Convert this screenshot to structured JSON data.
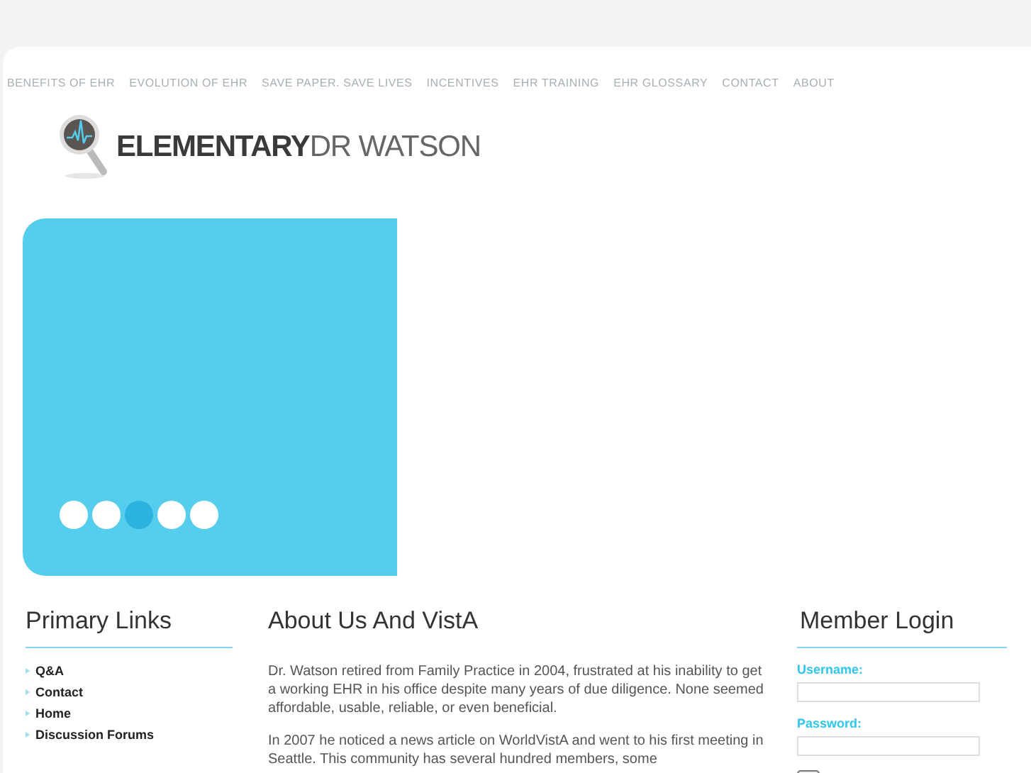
{
  "nav": [
    "BENEFITS OF EHR",
    "EVOLUTION OF EHR",
    "SAVE PAPER. SAVE LIVES",
    "INCENTIVES",
    "EHR TRAINING",
    "EHR GLOSSARY",
    "CONTACT",
    "ABOUT"
  ],
  "logo": {
    "strong": "ELEMENTARY",
    "light": "DR WATSON"
  },
  "slider": {
    "dots": [
      {
        "selected": false
      },
      {
        "selected": false
      },
      {
        "selected": true
      },
      {
        "selected": false
      },
      {
        "selected": false
      }
    ]
  },
  "primary_links": {
    "title": "Primary Links",
    "items": [
      "Q&A",
      "Contact",
      "Home",
      "Discussion Forums"
    ]
  },
  "article": {
    "title": "About Us And VistA",
    "paragraphs": [
      "Dr. Watson retired from Family Practice in 2004, frustrated at his inability to get a working EHR in his office despite many years of due diligence. None seemed affordable, usable, reliable, or even beneficial.",
      "In 2007 he noticed a news article on WorldVistA and went to his first meeting in Seattle. This community has several hundred members, some"
    ]
  },
  "login": {
    "title": "Member Login",
    "fields": [
      {
        "label": "Username:"
      },
      {
        "label": "Password:"
      }
    ]
  }
}
